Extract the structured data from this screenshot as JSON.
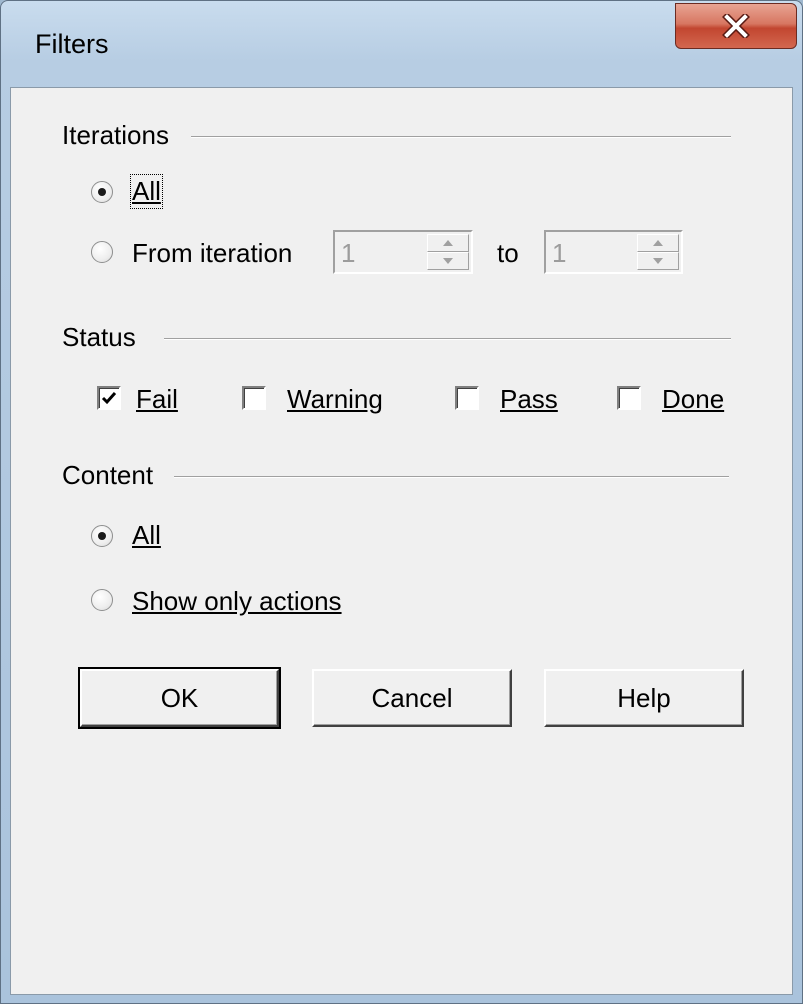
{
  "window": {
    "title": "Filters",
    "close_icon": "close-icon"
  },
  "iterations": {
    "legend": "Iterations",
    "all_label": "All",
    "from_label": "From iteration",
    "to_label": "to",
    "selected": "all",
    "from_value": "1",
    "to_value": "1"
  },
  "status": {
    "legend": "Status",
    "items": [
      {
        "label": "Fail",
        "checked": true
      },
      {
        "label": "Warning",
        "checked": false
      },
      {
        "label": "Pass",
        "checked": false
      },
      {
        "label": "Done",
        "checked": false
      }
    ]
  },
  "content": {
    "legend": "Content",
    "all_label": "All",
    "actions_label": "Show only actions",
    "selected": "all"
  },
  "buttons": {
    "ok": "OK",
    "cancel": "Cancel",
    "help": "Help"
  }
}
